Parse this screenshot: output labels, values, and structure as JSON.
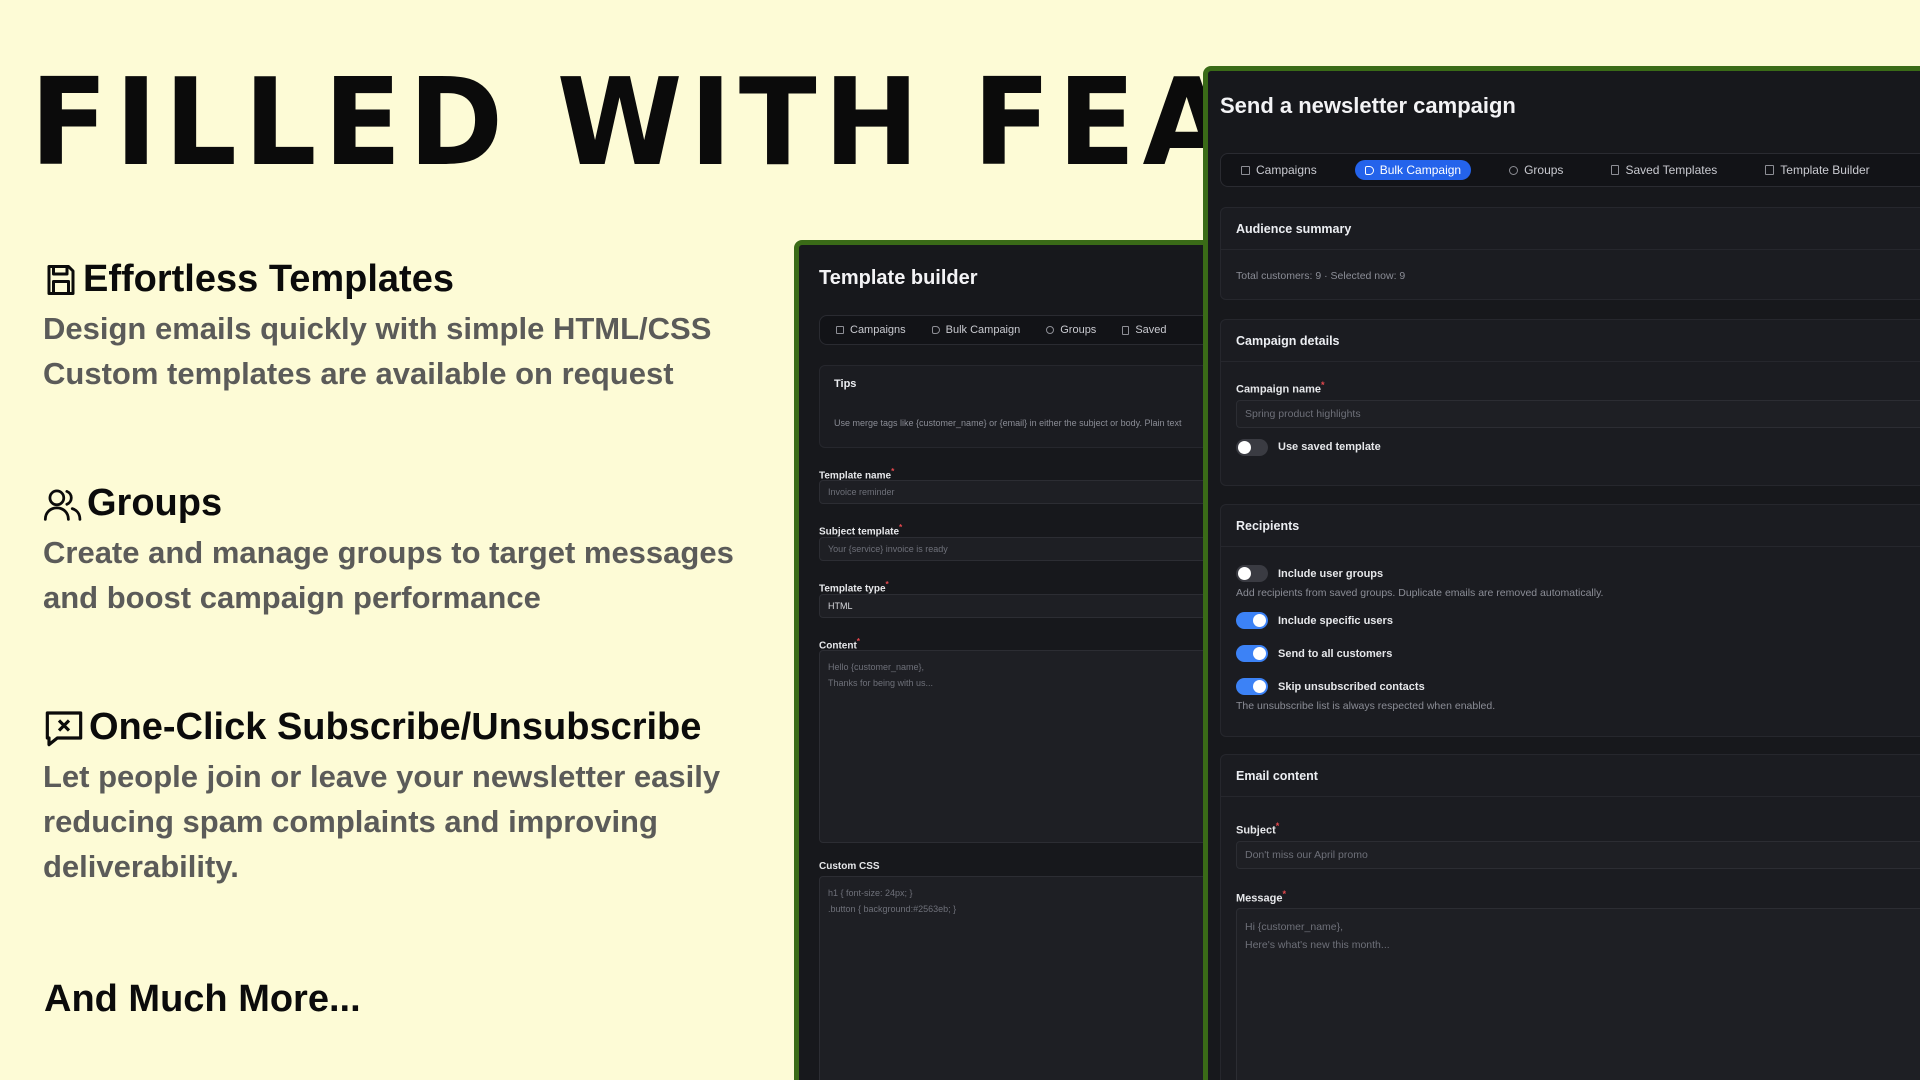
{
  "headline": "FILLED WITH FEATURES",
  "features": [
    {
      "title": "Effortless Templates",
      "lines": [
        "Design emails quickly with simple HTML/CSS",
        "Custom templates are available on request"
      ]
    },
    {
      "title": "Groups",
      "lines": [
        "Create and manage groups to target messages",
        "and boost campaign performance"
      ]
    },
    {
      "title": "One-Click Subscribe/Unsubscribe",
      "lines": [
        "Let people join or leave your newsletter easily",
        "reducing spam complaints and improving",
        "deliverability."
      ]
    }
  ],
  "more": "And Much More...",
  "template_builder": {
    "title": "Template builder",
    "tabs": [
      "Campaigns",
      "Bulk Campaign",
      "Groups",
      "Saved"
    ],
    "tips_title": "Tips",
    "tips_text": "Use merge tags like {customer_name} or {email} in either the subject or body. Plain text",
    "name_label": "Template name",
    "name_placeholder": "Invoice reminder",
    "subject_label": "Subject template",
    "subject_placeholder": "Your {service} invoice is ready",
    "type_label": "Template type",
    "type_value": "HTML",
    "content_label": "Content",
    "content_lines": [
      "Hello {customer_name},",
      "Thanks for being with us..."
    ],
    "css_label": "Custom CSS",
    "css_lines": [
      "h1 { font-size: 24px; }",
      ".button { background:#2563eb; }"
    ]
  },
  "campaign": {
    "title": "Send a newsletter campaign",
    "tabs": [
      "Campaigns",
      "Bulk Campaign",
      "Groups",
      "Saved Templates",
      "Template Builder"
    ],
    "active_tab": 1,
    "audience_title": "Audience summary",
    "audience_text": "Total customers: 9 · Selected now: 9",
    "details_title": "Campaign details",
    "name_label": "Campaign name",
    "name_placeholder": "Spring product highlights",
    "use_saved_label": "Use saved template",
    "recipients_title": "Recipients",
    "include_groups_label": "Include user groups",
    "include_groups_help": "Add recipients from saved groups. Duplicate emails are removed automatically.",
    "include_specific_label": "Include specific users",
    "send_all_label": "Send to all customers",
    "skip_unsub_label": "Skip unsubscribed contacts",
    "skip_unsub_help": "The unsubscribe list is always respected when enabled.",
    "content_title": "Email content",
    "subject_label": "Subject",
    "subject_placeholder": "Don't miss our April promo",
    "message_label": "Message",
    "message_lines": [
      "Hi {customer_name},",
      "Here's what's new this month..."
    ]
  },
  "colors": {
    "background": "#fdfbd6",
    "panel": "#17181c",
    "panel_border": "#3a6b17",
    "accent": "#2463eb",
    "muted_text": "#5b5b59"
  }
}
